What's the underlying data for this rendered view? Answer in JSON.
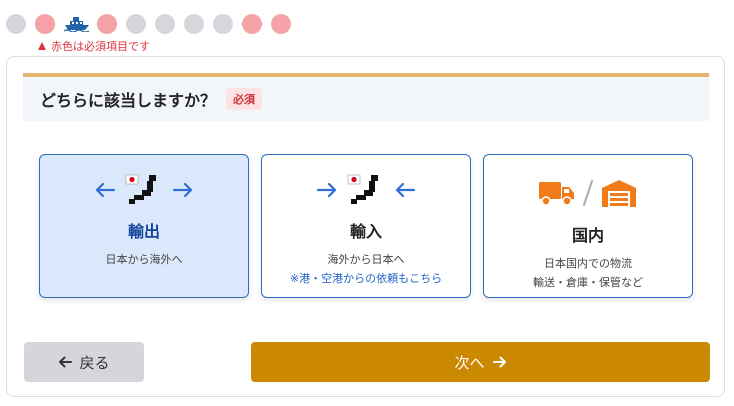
{
  "steps": [
    {
      "state": "done",
      "color": "#d6d7dc"
    },
    {
      "state": "required",
      "color": "#f5a3a6"
    },
    {
      "state": "current",
      "icon": "ship-icon"
    },
    {
      "state": "required",
      "color": "#f5a3a6"
    },
    {
      "state": "done",
      "color": "#d6d7dc"
    },
    {
      "state": "done",
      "color": "#d6d7dc"
    },
    {
      "state": "done",
      "color": "#d6d7dc"
    },
    {
      "state": "done",
      "color": "#d6d7dc"
    },
    {
      "state": "required",
      "color": "#f5a3a6"
    },
    {
      "state": "required",
      "color": "#f5a3a6"
    }
  ],
  "required_note": "赤色は必須項目です",
  "question": {
    "title": "どちらに該当しますか？",
    "badge": "必須"
  },
  "options": [
    {
      "title": "輸出",
      "subtitle": "日本から海外へ",
      "note": "",
      "selected": true,
      "icons": [
        "arrow-left-icon",
        "japan-map-icon",
        "arrow-right-icon"
      ]
    },
    {
      "title": "輸入",
      "subtitle": "海外から日本へ",
      "note": "※港・空港からの依頼もこちら",
      "selected": false,
      "icons": [
        "arrow-right-icon",
        "japan-map-icon",
        "arrow-left-icon"
      ]
    },
    {
      "title": "国内",
      "subtitle_lines": [
        "日本国内での物流",
        "輸送・倉庫・保管など"
      ],
      "selected": false,
      "icons": [
        "truck-icon",
        "warehouse-icon"
      ]
    }
  ],
  "buttons": {
    "back": "戻る",
    "next": "次へ"
  },
  "colors": {
    "accent": "#cb8902",
    "selected_bg": "#dbe8fb",
    "card_border": "#2f6fbd",
    "required_red": "#d9363e",
    "orange_icon": "#f27b19"
  }
}
